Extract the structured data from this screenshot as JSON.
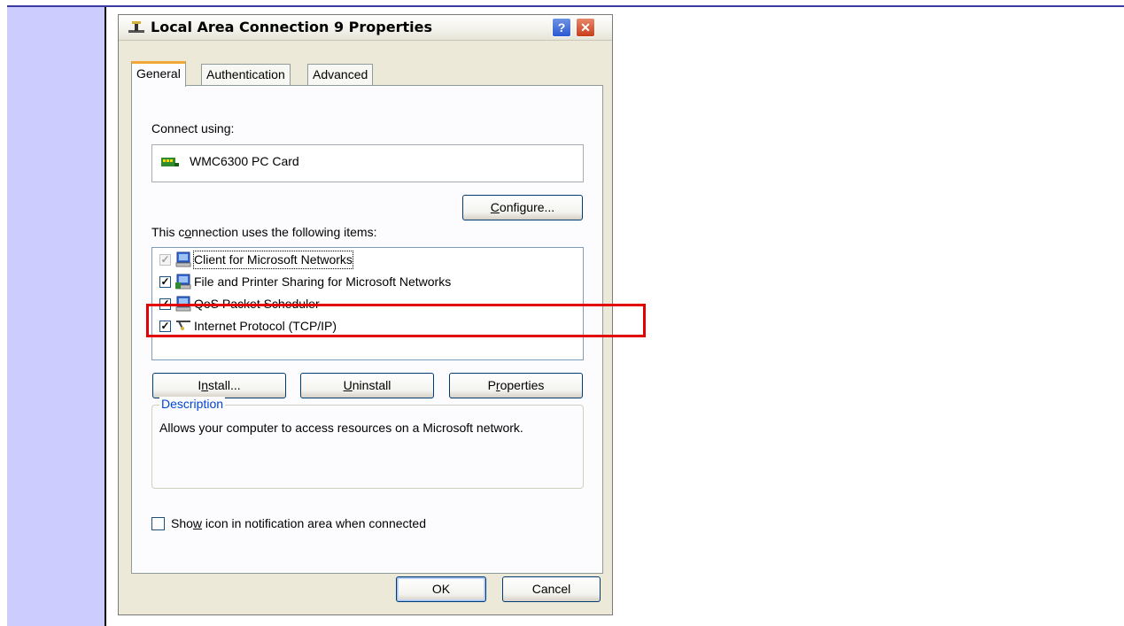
{
  "dialog": {
    "title": "Local Area Connection 9 Properties",
    "help_label": "?",
    "close_label": "✕"
  },
  "tabs": [
    {
      "label": "General",
      "active": true
    },
    {
      "label": "Authentication",
      "active": false
    },
    {
      "label": "Advanced",
      "active": false
    }
  ],
  "general": {
    "connect_using_label": "Connect using:",
    "device_name": "WMC6300 PC Card",
    "configure_pre": "",
    "configure_u": "C",
    "configure_post": "onfigure...",
    "items_label_pre": "This c",
    "items_label_u": "o",
    "items_label_post": "nnection uses the following items:",
    "items": [
      {
        "label": "Client for Microsoft Networks",
        "checked": true,
        "dimmed": true,
        "icon": "network-client-icon"
      },
      {
        "label": "File and Printer Sharing for Microsoft Networks",
        "checked": true,
        "dimmed": false,
        "icon": "file-sharing-icon"
      },
      {
        "label": "QoS Packet Scheduler",
        "checked": true,
        "dimmed": false,
        "icon": "qos-scheduler-icon"
      },
      {
        "label": "Internet Protocol (TCP/IP)",
        "checked": true,
        "dimmed": false,
        "icon": "protocol-icon"
      }
    ],
    "install_pre": "I",
    "install_u": "n",
    "install_post": "stall...",
    "uninstall_pre": "",
    "uninstall_u": "U",
    "uninstall_post": "ninstall",
    "properties_pre": "P",
    "properties_u": "r",
    "properties_post": "operties",
    "description_legend": "Description",
    "description_text": "Allows your computer to access resources on a Microsoft network.",
    "notify_pre": "Sho",
    "notify_u": "w",
    "notify_post": " icon in notification area when connected",
    "notify_checked": false
  },
  "footer": {
    "ok_label": "OK",
    "cancel_label": "Cancel"
  },
  "colors": {
    "highlight": "#e30000",
    "side_panel": "#ccccff"
  }
}
